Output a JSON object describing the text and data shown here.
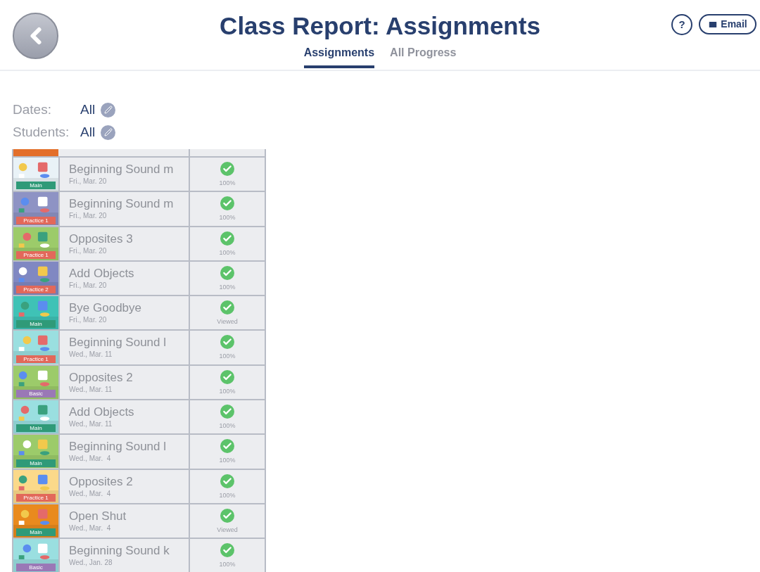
{
  "header": {
    "title": "Class Report: Assignments",
    "help": "?",
    "email": "Email"
  },
  "tabs": [
    {
      "label": "Assignments",
      "selected": true
    },
    {
      "label": "All Progress",
      "selected": false
    }
  ],
  "filters": [
    {
      "label": "Dates:",
      "value": "All"
    },
    {
      "label": "Students:",
      "value": "All"
    }
  ],
  "assignments": [
    {
      "title": "Beginning Sound m",
      "date": "Fri., Mar. 20",
      "badge": "Main",
      "color": "#2f9a78",
      "done": true,
      "result": "100%"
    },
    {
      "title": "Beginning Sound m",
      "date": "Fri., Mar. 20",
      "badge": "Practice 1",
      "color": "#e2685a",
      "done": true,
      "result": "100%"
    },
    {
      "title": "Opposites 3",
      "date": "Fri., Mar. 20",
      "badge": "Practice 1",
      "color": "#e2685a",
      "done": true,
      "result": "100%"
    },
    {
      "title": "Add Objects",
      "date": "Fri., Mar. 20",
      "badge": "Practice 2",
      "color": "#e2685a",
      "done": true,
      "result": "100%"
    },
    {
      "title": "Bye Goodbye",
      "date": "Fri., Mar. 20",
      "badge": "Main",
      "color": "#2f9a78",
      "done": true,
      "result": "Viewed"
    },
    {
      "title": "Beginning Sound l",
      "date": "Wed., Mar. 11",
      "badge": "Practice 1",
      "color": "#e2685a",
      "done": true,
      "result": "100%"
    },
    {
      "title": "Opposites 2",
      "date": "Wed., Mar. 11",
      "badge": "Basic",
      "color": "#9a78b6",
      "done": true,
      "result": "100%"
    },
    {
      "title": "Add Objects",
      "date": "Wed., Mar. 11",
      "badge": "Main",
      "color": "#2f9a78",
      "done": true,
      "result": "100%"
    },
    {
      "title": "Beginning Sound l",
      "date": "Wed., Mar.  4",
      "badge": "Main",
      "color": "#2f9a78",
      "done": true,
      "result": "100%"
    },
    {
      "title": "Opposites 2",
      "date": "Wed., Mar.  4",
      "badge": "Practice 1",
      "color": "#e2685a",
      "done": true,
      "result": "100%"
    },
    {
      "title": "Open Shut",
      "date": "Wed., Mar.  4",
      "badge": "Main",
      "color": "#2f9a78",
      "done": true,
      "result": "Viewed"
    },
    {
      "title": "Beginning Sound k",
      "date": "Wed., Jan. 28",
      "badge": "Basic",
      "color": "#9a78b6",
      "done": true,
      "result": "100%"
    }
  ]
}
